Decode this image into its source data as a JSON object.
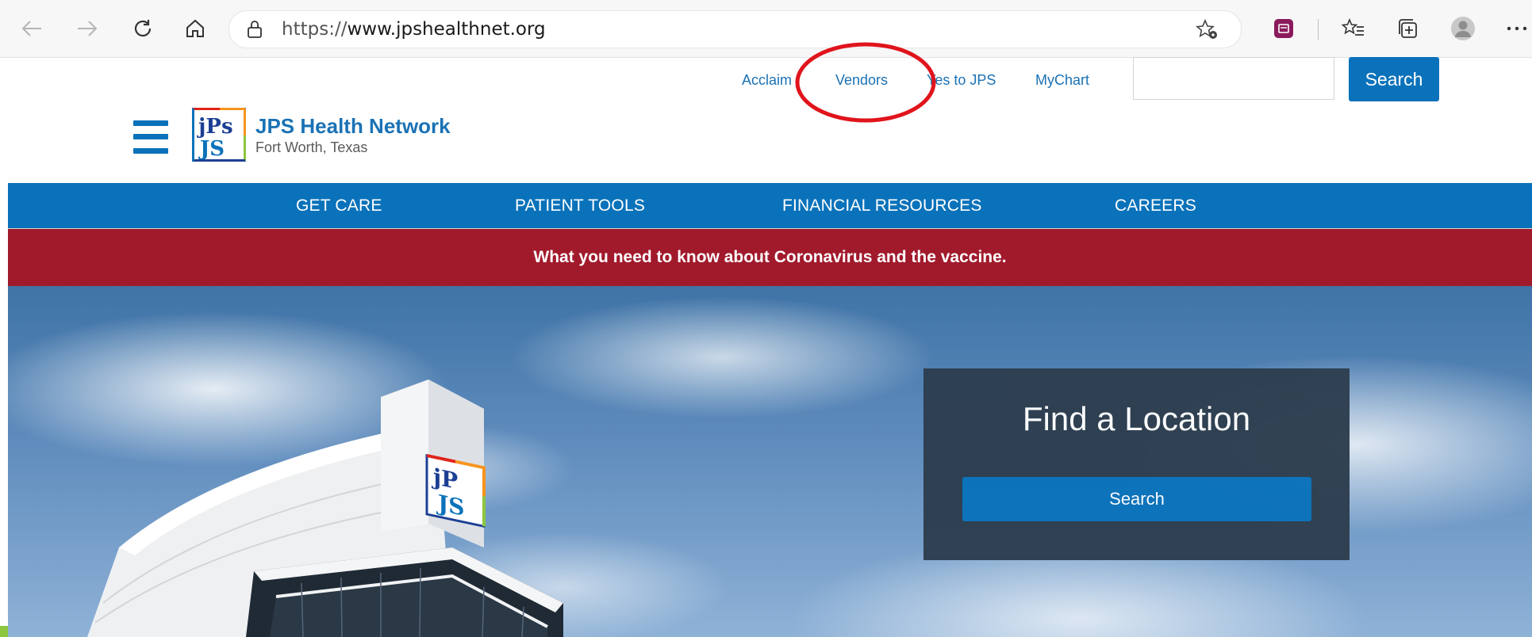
{
  "browser": {
    "url_prefix": "https://",
    "url_host": "www.jpshealthnet.org"
  },
  "utility_nav": {
    "links": [
      "Acclaim",
      "Vendors",
      "Yes to JPS",
      "MyChart"
    ],
    "search_value": "",
    "search_button": "Search"
  },
  "brand": {
    "name": "JPS Health Network",
    "location": "Fort Worth, Texas"
  },
  "main_nav": {
    "items": [
      "GET CARE",
      "PATIENT TOOLS",
      "FINANCIAL RESOURCES",
      "CAREERS"
    ]
  },
  "alert": {
    "text": "What you need to know about Coronavirus and the vaccine."
  },
  "find_location": {
    "title": "Find a Location",
    "button": "Search"
  },
  "colors": {
    "brand_blue": "#0a72ba",
    "alert_red": "#a11a2c",
    "card_bg": "#2d3e4f",
    "annotation": "#e0141c"
  }
}
